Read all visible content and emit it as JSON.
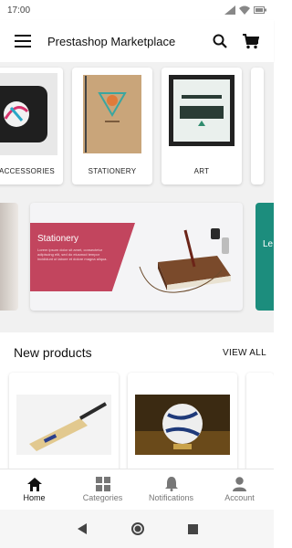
{
  "status_bar": {
    "time": "17:00",
    "battery_icon": "battery-icon",
    "wifi_icon": "wifi-icon",
    "signal_icon": "signal-icon"
  },
  "app_bar": {
    "title": "Prestashop Marketplace",
    "menu_icon": "menu-icon",
    "search_icon": "search-icon",
    "cart_icon": "cart-icon"
  },
  "categories": [
    {
      "label": "ACCESSORIES"
    },
    {
      "label": "STATIONERY"
    },
    {
      "label": "ART"
    }
  ],
  "banners": [
    {
      "title": "Stationery",
      "text": "Lorem ipsum dolor sit amet, consectetur adipiscing elit, sed do eiusmod tempor incididunt ut labore et dolore magna aliqua."
    },
    {
      "title": "Le"
    }
  ],
  "new_products": {
    "title": "New products",
    "view_all": "VIEW ALL"
  },
  "bottom_nav": [
    {
      "label": "Home",
      "icon": "home-icon",
      "active": true
    },
    {
      "label": "Categories",
      "icon": "categories-icon",
      "active": false
    },
    {
      "label": "Notifications",
      "icon": "bell-icon",
      "active": false
    },
    {
      "label": "Account",
      "icon": "account-icon",
      "active": false
    }
  ],
  "colors": {
    "accent": "#c2455e",
    "teal": "#1c8d7d",
    "background": "#f1f1f1"
  }
}
